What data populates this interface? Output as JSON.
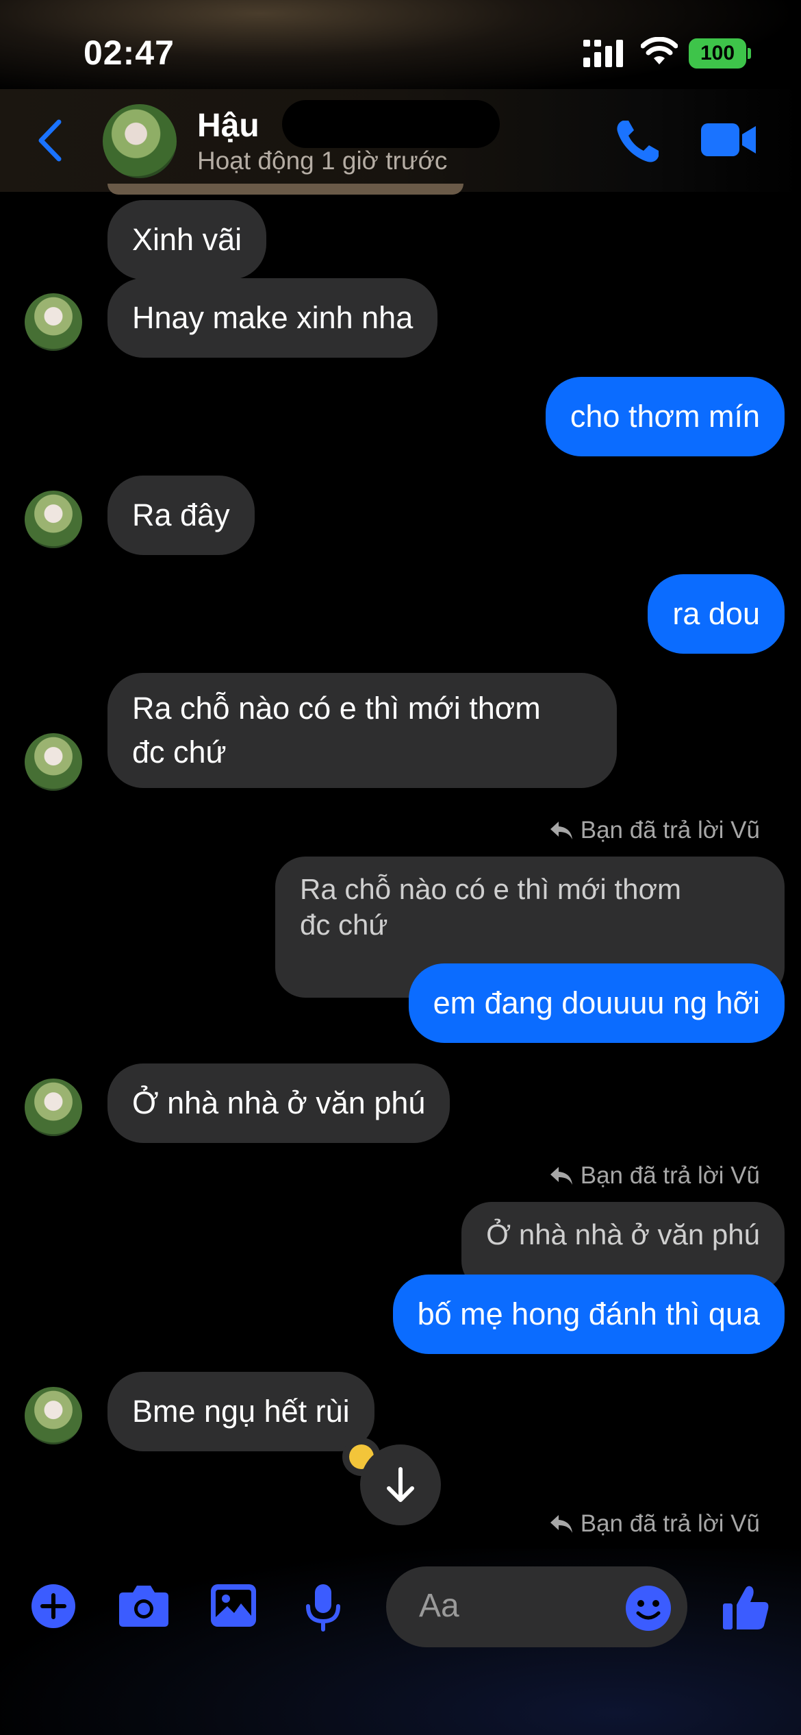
{
  "status": {
    "time": "02:47",
    "battery": "100"
  },
  "header": {
    "name": "Hậu",
    "presence": "Hoạt động 1 giờ trước"
  },
  "messages": [
    {
      "side": "in",
      "text": "Xinh vãi"
    },
    {
      "side": "in",
      "text": "Hnay make xinh nha"
    },
    {
      "side": "out",
      "text": "cho thơm mín"
    },
    {
      "side": "in",
      "text": "Ra đây"
    },
    {
      "side": "out",
      "text": "ra dou"
    },
    {
      "side": "in",
      "line1": "Ra chỗ nào có e thì mới thơm",
      "line2": "đc chứ"
    },
    {
      "side": "out",
      "reply_note": "Bạn đã trả lời Vũ",
      "quote_line1": "Ra chỗ nào có e thì mới thơm",
      "quote_line2": "đc chứ",
      "text": "em đang douuuu ng hỡi"
    },
    {
      "side": "in",
      "text": "Ở nhà nhà ở văn phú"
    },
    {
      "side": "out",
      "reply_note": "Bạn đã trả lời Vũ",
      "quote": "Ở nhà nhà ở văn phú",
      "text": "bố mẹ hong đánh thì qua"
    },
    {
      "side": "in",
      "text": "Bme ngụ hết rùi"
    },
    {
      "side": "out",
      "reply_note": "Bạn đã trả lời Vũ"
    }
  ],
  "composer": {
    "placeholder": "Aa"
  },
  "colors": {
    "accent": "#0b6cff",
    "icon_blue": "#3b5cff",
    "bubble_in": "#2e2e2f"
  }
}
